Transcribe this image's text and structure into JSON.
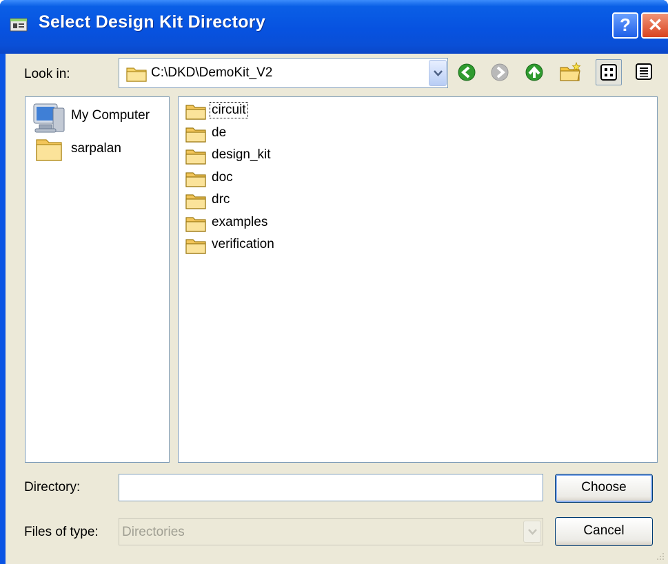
{
  "window": {
    "title": "Select Design Kit Directory",
    "help_label": "?",
    "close_label": "✕"
  },
  "toolbar": {
    "look_in_label": "Look in:",
    "look_in_value": "C:\\DKD\\DemoKit_V2",
    "icons": [
      "back-icon",
      "forward-icon",
      "up-folder-icon",
      "new-folder-icon",
      "list-view-icon",
      "details-view-icon"
    ]
  },
  "places": [
    {
      "label": "My Computer",
      "icon": "computer-icon"
    },
    {
      "label": "sarpalan",
      "icon": "folder-icon"
    }
  ],
  "files": [
    {
      "name": "circuit"
    },
    {
      "name": "de"
    },
    {
      "name": "design_kit"
    },
    {
      "name": "doc"
    },
    {
      "name": "drc"
    },
    {
      "name": "examples"
    },
    {
      "name": "verification"
    }
  ],
  "footer": {
    "directory_label": "Directory:",
    "directory_value": "",
    "files_of_type_label": "Files of type:",
    "files_of_type_value": "Directories",
    "choose_label": "Choose",
    "cancel_label": "Cancel"
  },
  "colors": {
    "titlebar": "#0752e0",
    "dialog_bg": "#ece9d8",
    "close_button": "#d9431f"
  }
}
